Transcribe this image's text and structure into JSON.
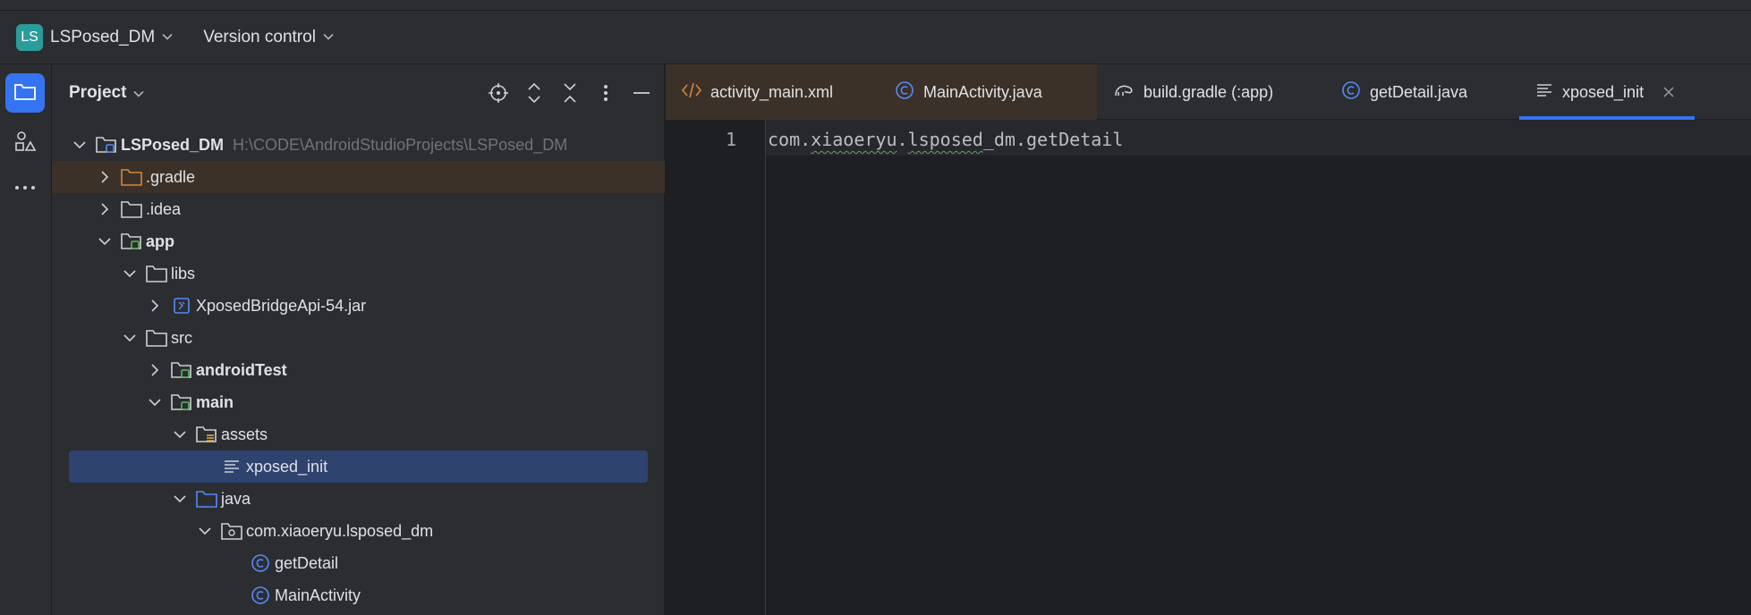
{
  "titlebar": {
    "project_badge": "LS",
    "project_name": "LSPosed_DM",
    "vcs_label": "Version control"
  },
  "toolstrip": {
    "items": [
      "folder-icon",
      "structure-icon",
      "more-icon"
    ]
  },
  "project_panel": {
    "title": "Project",
    "actions": [
      "locate-icon",
      "expand-all-icon",
      "collapse-all-icon",
      "options-icon",
      "hide-icon"
    ],
    "tree": [
      {
        "label": "LSPosed_DM",
        "path": "H:\\CODE\\AndroidStudioProjects\\LSPosed_DM",
        "bold": true
      },
      {
        "label": ".gradle"
      },
      {
        "label": ".idea"
      },
      {
        "label": "app",
        "bold": true
      },
      {
        "label": "libs"
      },
      {
        "label": "XposedBridgeApi-54.jar"
      },
      {
        "label": "src"
      },
      {
        "label": "androidTest",
        "bold": true
      },
      {
        "label": "main",
        "bold": true
      },
      {
        "label": "assets"
      },
      {
        "label": "xposed_init",
        "selected": true
      },
      {
        "label": "java"
      },
      {
        "label": "com.xiaoeryu.lsposed_dm"
      },
      {
        "label": "getDetail"
      },
      {
        "label": "MainActivity"
      }
    ]
  },
  "editor": {
    "tabs": [
      {
        "label": "activity_main.xml",
        "icon": "xml-icon",
        "modified": true
      },
      {
        "label": "MainActivity.java",
        "icon": "java-class-icon",
        "modified": true
      },
      {
        "label": "build.gradle (:app)",
        "icon": "gradle-icon"
      },
      {
        "label": "getDetail.java",
        "icon": "java-class-icon"
      },
      {
        "label": "xposed_init",
        "icon": "text-file-icon",
        "active": true
      }
    ],
    "lines": [
      {
        "number": "1",
        "segments": [
          "com.",
          "xiaoeryu",
          ".",
          "lsposed",
          "_dm.getDetail"
        ]
      }
    ]
  },
  "colors": {
    "accent": "#3574f0",
    "selection": "#2e436e",
    "modified_bg": "#3b3128",
    "folder_orange": "#d8863c",
    "class_blue": "#548af7",
    "module_green": "#5fb865"
  }
}
